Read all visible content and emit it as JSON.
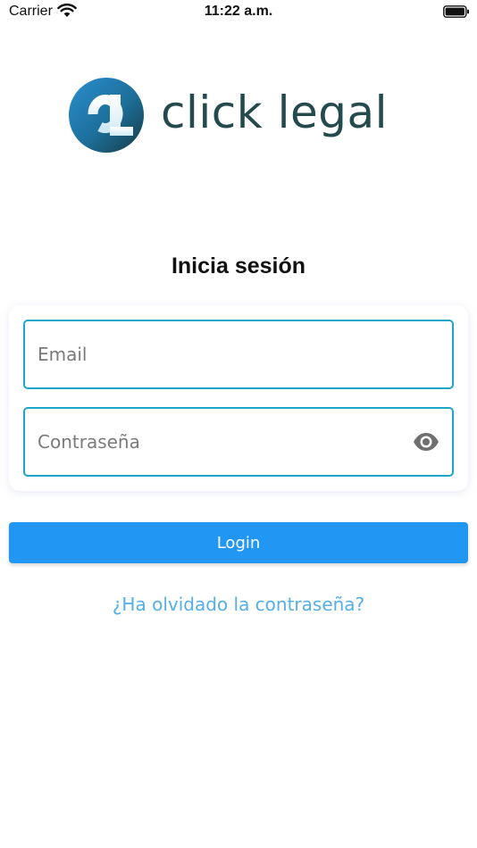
{
  "status_bar": {
    "carrier": "Carrier",
    "time": "11:22 a.m.",
    "wifi_icon": "wifi-icon",
    "battery_icon": "battery-icon"
  },
  "logo": {
    "mark_text": "CL",
    "text": "click legal",
    "text_color": "#244a4e"
  },
  "title": "Inicia sesión",
  "form": {
    "email_placeholder": "Email",
    "email_value": "",
    "password_placeholder": "Contraseña",
    "password_value": "",
    "toggle_icon": "eye-icon",
    "border_color": "#1ea6c8"
  },
  "login_button": {
    "label": "Login",
    "color": "#2196f3"
  },
  "forgot_password": {
    "label": "¿Ha olvidado la contraseña?",
    "color": "#55aee6"
  }
}
